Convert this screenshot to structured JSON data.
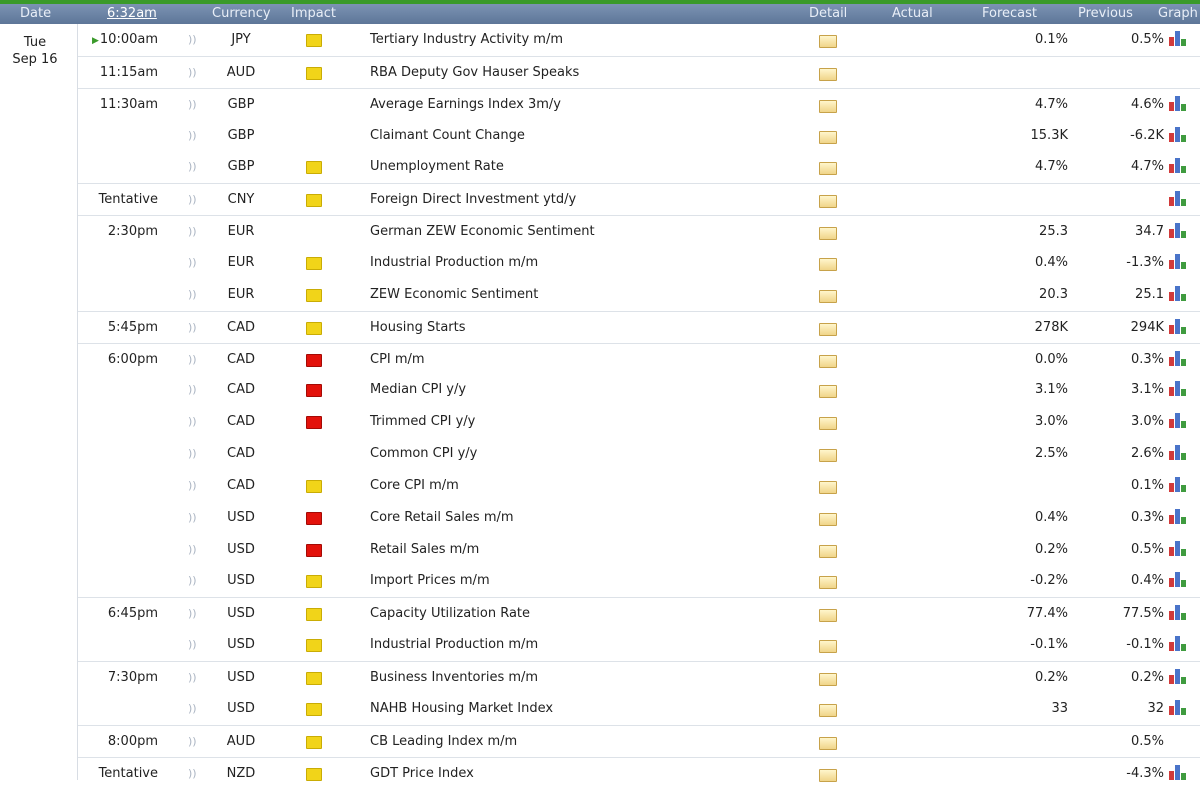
{
  "header": {
    "date": "Date",
    "time": "6:32am",
    "currency": "Currency",
    "impact": "Impact",
    "detail": "Detail",
    "actual": "Actual",
    "forecast": "Forecast",
    "previous": "Previous",
    "graph": "Graph"
  },
  "date": {
    "weekday": "Tue",
    "day": "Sep 16"
  },
  "icons": {
    "speaker": "speaker-icon",
    "detail": "folder-icon",
    "graph": "bar-chart-icon",
    "current": "play-arrow-icon"
  },
  "colors": {
    "low": "#f1d419",
    "medium": "#ee8e2e",
    "high": "#e3120b",
    "header": "#6a82a5",
    "current": "#3a9a2a"
  },
  "events": [
    {
      "time": "10:00am",
      "currency": "JPY",
      "impact": "low",
      "name": "Tertiary Industry Activity m/m",
      "forecast": "0.1%",
      "previous": "0.5%",
      "graph": true,
      "current": true
    },
    {
      "time": "11:15am",
      "currency": "AUD",
      "impact": "low",
      "name": "RBA Deputy Gov Hauser Speaks",
      "forecast": "",
      "previous": "",
      "graph": false
    },
    {
      "time": "11:30am",
      "currency": "GBP",
      "impact": "medium",
      "name": "Average Earnings Index 3m/y",
      "forecast": "4.7%",
      "previous": "4.6%",
      "graph": true
    },
    {
      "time": "",
      "currency": "GBP",
      "impact": "medium",
      "name": "Claimant Count Change",
      "forecast": "15.3K",
      "previous": "-6.2K",
      "graph": true
    },
    {
      "time": "",
      "currency": "GBP",
      "impact": "low",
      "name": "Unemployment Rate",
      "forecast": "4.7%",
      "previous": "4.7%",
      "graph": true
    },
    {
      "time": "Tentative",
      "currency": "CNY",
      "impact": "low",
      "name": "Foreign Direct Investment ytd/y",
      "forecast": "",
      "previous": "",
      "graph": true
    },
    {
      "time": "2:30pm",
      "currency": "EUR",
      "impact": "medium",
      "name": "German ZEW Economic Sentiment",
      "forecast": "25.3",
      "previous": "34.7",
      "graph": true
    },
    {
      "time": "",
      "currency": "EUR",
      "impact": "low",
      "name": "Industrial Production m/m",
      "forecast": "0.4%",
      "previous": "-1.3%",
      "graph": true
    },
    {
      "time": "",
      "currency": "EUR",
      "impact": "low",
      "name": "ZEW Economic Sentiment",
      "forecast": "20.3",
      "previous": "25.1",
      "graph": true
    },
    {
      "time": "5:45pm",
      "currency": "CAD",
      "impact": "low",
      "name": "Housing Starts",
      "forecast": "278K",
      "previous": "294K",
      "graph": true
    },
    {
      "time": "6:00pm",
      "currency": "CAD",
      "impact": "high",
      "name": "CPI m/m",
      "forecast": "0.0%",
      "previous": "0.3%",
      "graph": true
    },
    {
      "time": "",
      "currency": "CAD",
      "impact": "high",
      "name": "Median CPI y/y",
      "forecast": "3.1%",
      "previous": "3.1%",
      "graph": true
    },
    {
      "time": "",
      "currency": "CAD",
      "impact": "high",
      "name": "Trimmed CPI y/y",
      "forecast": "3.0%",
      "previous": "3.0%",
      "graph": true
    },
    {
      "time": "",
      "currency": "CAD",
      "impact": "medium",
      "name": "Common CPI y/y",
      "forecast": "2.5%",
      "previous": "2.6%",
      "graph": true
    },
    {
      "time": "",
      "currency": "CAD",
      "impact": "low",
      "name": "Core CPI m/m",
      "forecast": "",
      "previous": "0.1%",
      "graph": true
    },
    {
      "time": "",
      "currency": "USD",
      "impact": "high",
      "name": "Core Retail Sales m/m",
      "forecast": "0.4%",
      "previous": "0.3%",
      "graph": true
    },
    {
      "time": "",
      "currency": "USD",
      "impact": "high",
      "name": "Retail Sales m/m",
      "forecast": "0.2%",
      "previous": "0.5%",
      "graph": true
    },
    {
      "time": "",
      "currency": "USD",
      "impact": "low",
      "name": "Import Prices m/m",
      "forecast": "-0.2%",
      "previous": "0.4%",
      "graph": true
    },
    {
      "time": "6:45pm",
      "currency": "USD",
      "impact": "low",
      "name": "Capacity Utilization Rate",
      "forecast": "77.4%",
      "previous": "77.5%",
      "graph": true
    },
    {
      "time": "",
      "currency": "USD",
      "impact": "low",
      "name": "Industrial Production m/m",
      "forecast": "-0.1%",
      "previous": "-0.1%",
      "graph": true
    },
    {
      "time": "7:30pm",
      "currency": "USD",
      "impact": "low",
      "name": "Business Inventories m/m",
      "forecast": "0.2%",
      "previous": "0.2%",
      "graph": true
    },
    {
      "time": "",
      "currency": "USD",
      "impact": "low",
      "name": "NAHB Housing Market Index",
      "forecast": "33",
      "previous": "32",
      "graph": true
    },
    {
      "time": "8:00pm",
      "currency": "AUD",
      "impact": "low",
      "name": "CB Leading Index m/m",
      "forecast": "",
      "previous": "0.5%",
      "graph": false
    },
    {
      "time": "Tentative",
      "currency": "NZD",
      "impact": "low",
      "name": "GDT Price Index",
      "forecast": "",
      "previous": "-4.3%",
      "graph": true
    }
  ]
}
